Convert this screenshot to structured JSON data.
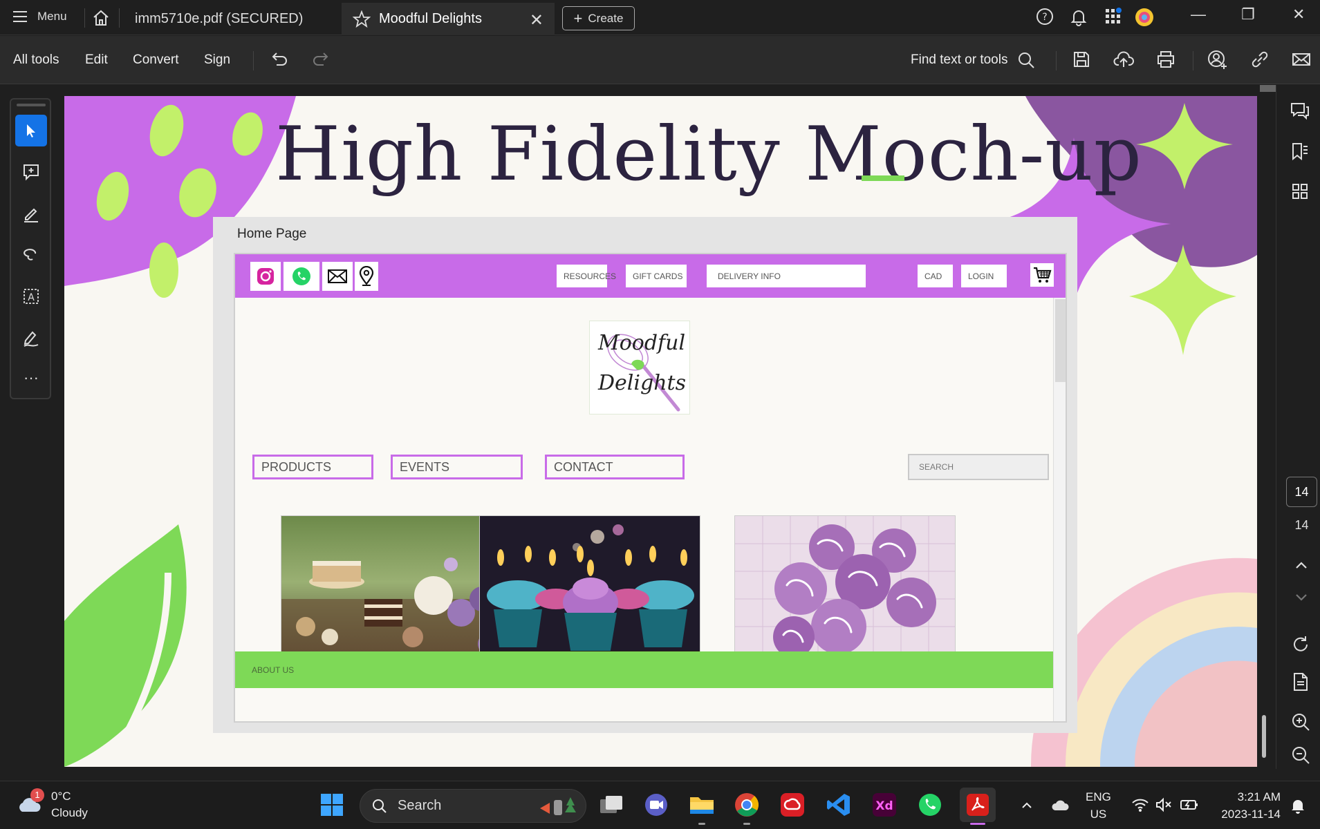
{
  "titlebar": {
    "menu_label": "Menu",
    "tabs": [
      {
        "label": "imm5710e.pdf (SECURED)"
      },
      {
        "label": "Moodful Delights"
      }
    ],
    "create_label": "Create"
  },
  "toolbar": {
    "items": [
      "All tools",
      "Edit",
      "Convert",
      "Sign"
    ],
    "find_label": "Find text or tools"
  },
  "page_nav": {
    "current_page": "14",
    "total_pages": "14"
  },
  "document": {
    "title": "High Fidelity Moch-up",
    "frame_label": "Home Page",
    "site": {
      "nav_buttons": [
        "RESOURCES",
        "GIFT CARDS",
        "DELIVERY INFO",
        "CAD",
        "LOGIN"
      ],
      "logo_text": [
        "Moodful",
        "Delights"
      ],
      "categories": [
        "PRODUCTS",
        "EVENTS",
        "CONTACT"
      ],
      "search_placeholder": "SEARCH",
      "footer_label": "ABOUT US"
    }
  },
  "taskbar": {
    "weather_badge": "1",
    "temperature": "0°C",
    "condition": "Cloudy",
    "search_label": "Search",
    "lang_line1": "ENG",
    "lang_line2": "US",
    "time": "3:21 AM",
    "date": "2023-11-14"
  },
  "colors": {
    "accent_blue": "#1473e6",
    "site_purple": "#c86be8",
    "site_green": "#7ed957",
    "page_bg": "#f9f7f2",
    "title_text": "#2c2340"
  }
}
